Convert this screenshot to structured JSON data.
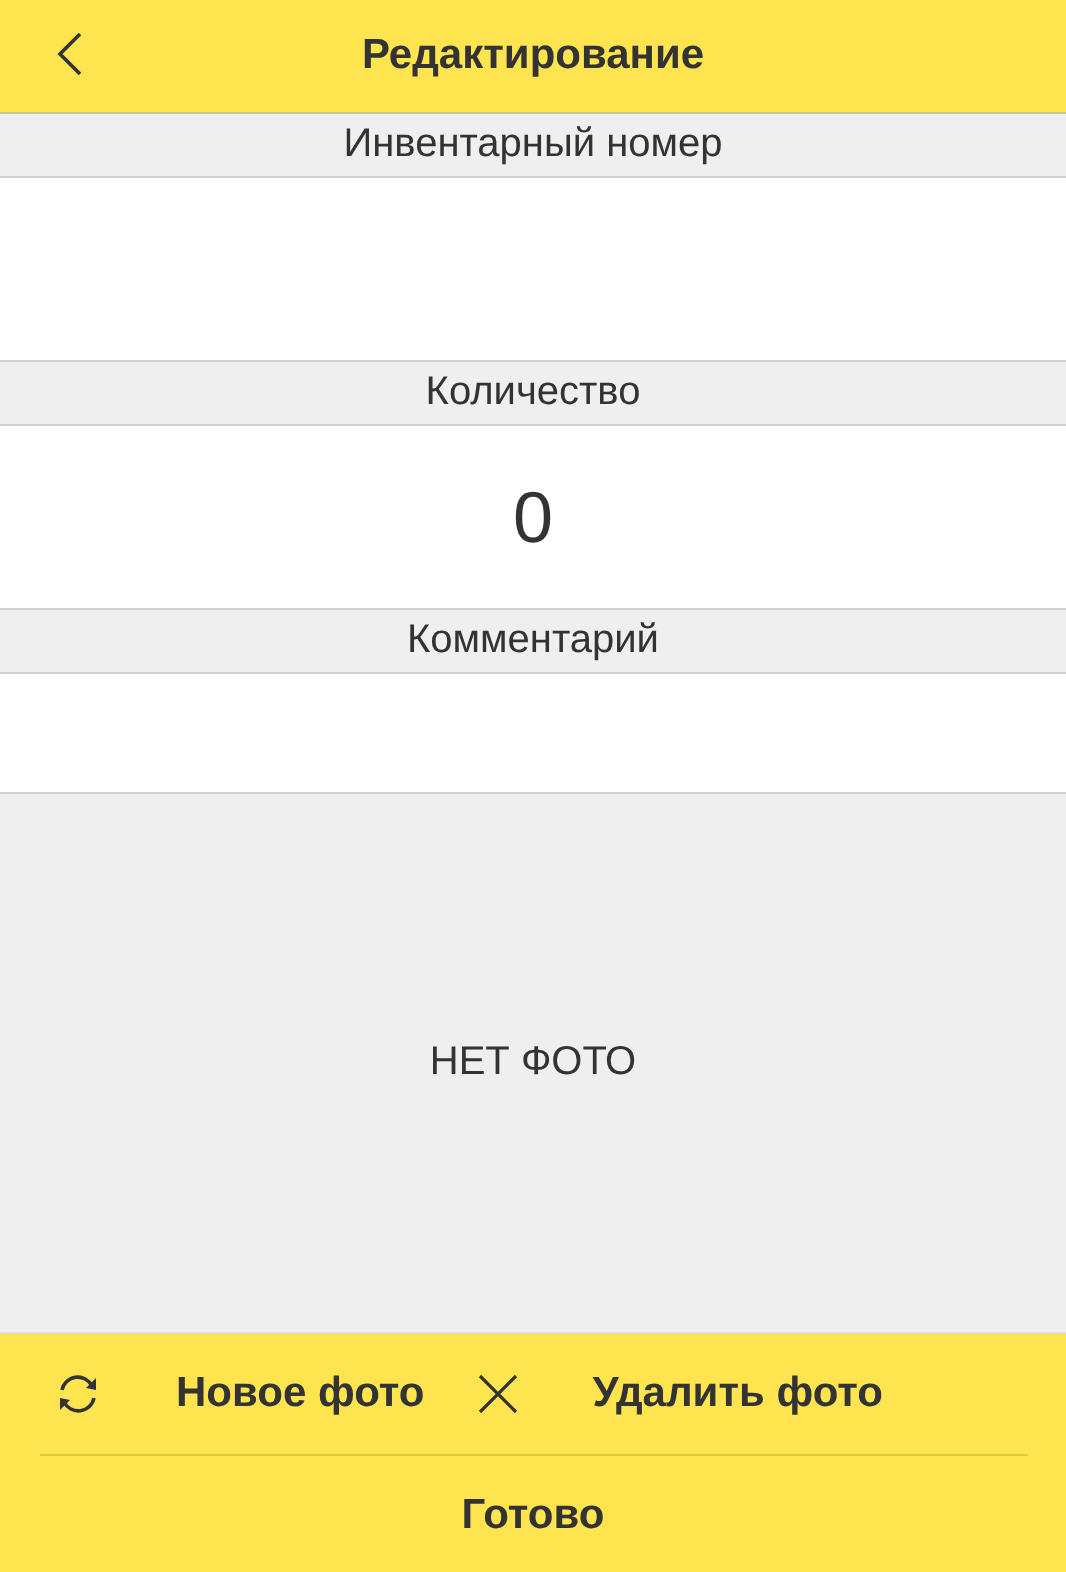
{
  "header": {
    "title": "Редактирование"
  },
  "fields": [
    {
      "label": "Инвентарный номер",
      "kind": "tall"
    },
    {
      "label": "Количество",
      "kind": "tall",
      "value": "0"
    },
    {
      "label": "Комментарий",
      "kind": "short"
    }
  ],
  "photo": {
    "empty_text": "НЕТ ФОТО"
  },
  "actions": [
    {
      "kind": "refresh",
      "label": "Новое фото"
    },
    {
      "kind": "delete",
      "label": "Удалить фото"
    }
  ],
  "done_button": "Готово"
}
